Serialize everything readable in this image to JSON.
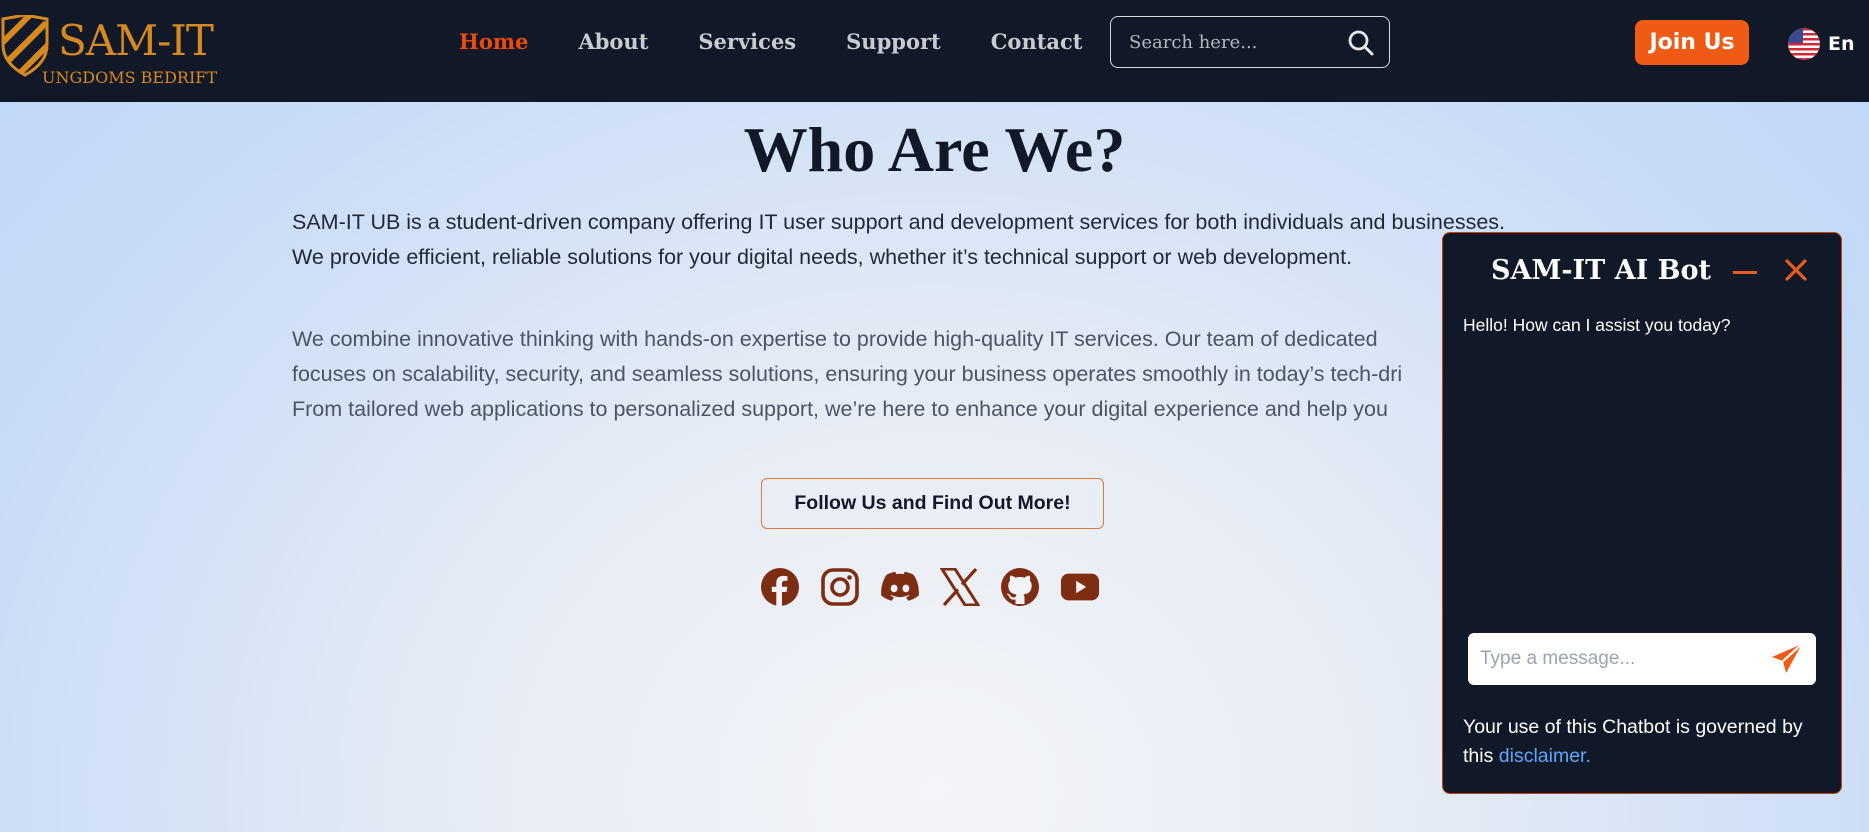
{
  "brand": {
    "name": "SAM-IT",
    "subtitle": "UNGDOMS BEDRIFT",
    "accent_color": "#d6891f"
  },
  "nav": {
    "links": [
      "Home",
      "About",
      "Services",
      "Support",
      "Contact"
    ],
    "active": "Home",
    "active_color": "#ef4a0c"
  },
  "search": {
    "placeholder": "Search here..."
  },
  "header": {
    "join_label": "Join Us",
    "language_label": "En",
    "join_color": "#ef5a15"
  },
  "main": {
    "title": "Who Are We?",
    "intro_line1": "SAM-IT UB is a student-driven company offering IT user support and development services for both individuals and businesses.",
    "intro_line2": "We provide efficient, reliable solutions for your digital needs, whether it’s technical support or web development.",
    "detail_line1": "We combine innovative thinking with hands-on expertise to provide high-quality IT services. Our team of dedicated",
    "detail_line2": "focuses on scalability, security, and seamless solutions, ensuring your business operates smoothly in today’s tech-dri",
    "detail_line3": "From tailored web applications to personalized support, we’re here to enhance your digital experience and help you",
    "follow_label": "Follow Us and Find Out More!",
    "socials": [
      "facebook-icon",
      "instagram-icon",
      "discord-icon",
      "x-icon",
      "github-icon",
      "youtube-icon"
    ],
    "social_color": "#7c2d12"
  },
  "chatbot": {
    "title": "SAM-IT AI Bot",
    "greeting": "Hello! How can I assist you today?",
    "input_placeholder": "Type a message...",
    "disclaimer_text": "Your use of this Chatbot is governed by this ",
    "disclaimer_link": "disclaimer."
  }
}
